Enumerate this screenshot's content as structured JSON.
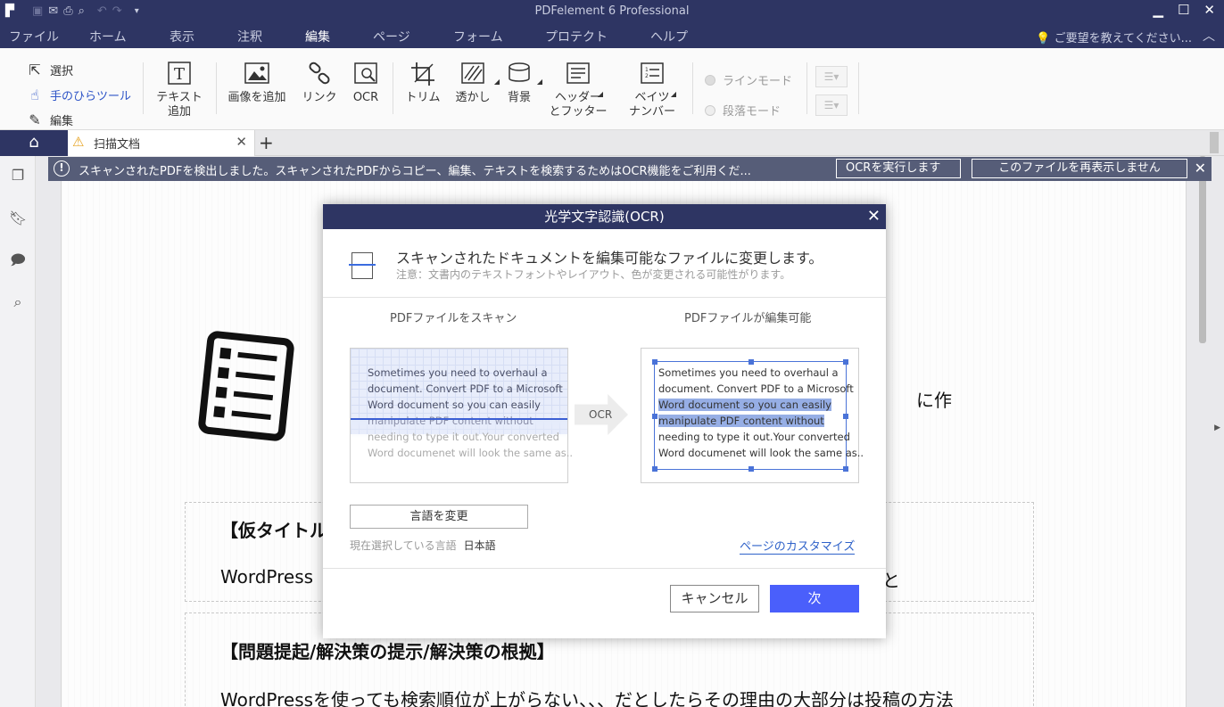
{
  "app": {
    "title": "PDFelement 6 Professional",
    "quick_access": [
      "logo-icon",
      "save-icon",
      "email-icon",
      "print-icon",
      "print-preview-icon",
      "undo-icon",
      "redo-icon",
      "customize-icon"
    ],
    "window_buttons": [
      "minimize-icon",
      "maximize-icon",
      "close-icon"
    ]
  },
  "menu": {
    "items": [
      "ファイル",
      "ホーム",
      "表示",
      "注釈",
      "編集",
      "ページ",
      "フォーム",
      "プロテクト",
      "ヘルプ"
    ],
    "active": "編集",
    "feedback": "ご要望を教えてください..."
  },
  "toolbar": {
    "modes": [
      {
        "label": "選択",
        "icon": "select-cursor-icon"
      },
      {
        "label": "手のひらツール",
        "icon": "hand-icon"
      },
      {
        "label": "編集",
        "icon": "edit-icon"
      }
    ],
    "tools": {
      "add_text": "テキスト\n追加",
      "add_image": "画像を追加",
      "link": "リンク",
      "ocr": "OCR",
      "crop": "トリム",
      "watermark": "透かし",
      "background": "背景",
      "header_footer": "ヘッダー\nとフッター",
      "bates": "ベイツ\nナンバー"
    },
    "line_mode": "ラインモード",
    "paragraph_mode": "段落モード"
  },
  "tabs": {
    "home_icon": "home-icon",
    "doc_tab": "扫描文档"
  },
  "notice": {
    "message": "スキャンされたPDFを検出しました。スキャンされたPDFからコピー、編集、テキストを検索するためはOCR機能をご利用くだ...",
    "run_ocr": "OCRを実行します",
    "dont_show": "このファイルを再表示しません"
  },
  "document": {
    "fragment_right": "に作",
    "heading1": "【仮タイトル",
    "para1": "WordPress",
    "para1_right": "と",
    "heading2": "【問題提起/解決策の提示/解決策の根拠】",
    "para2": "WordPressを使っても検索順位が上がらない、、、だとしたらその理由の大部分は投稿の方法"
  },
  "dialog": {
    "title": "光学文字認識(OCR)",
    "intro": "スキャンされたドキュメントを編集可能なファイルに変更します。",
    "note": "注意：文書内のテキストフォントやレイアウト、色が変更される可能性がります。",
    "left_title": "PDFファイルをスキャン",
    "right_title": "PDFファイルが編集可能",
    "sample_lines": [
      "Sometimes you need to overhaul a",
      "document. Convert PDF to a Microsoft",
      "Word document so you can easily",
      "manipulate PDF content without",
      "needing to type it out.Your converted",
      "Word documenet will look the same as.."
    ],
    "arrow_label": "OCR",
    "change_language": "言語を変更",
    "current_language_label": "現在選択している言語",
    "current_language": "日本語",
    "customize_pages": "ページのカスタマイズ",
    "cancel": "キャンセル",
    "next": "次"
  }
}
